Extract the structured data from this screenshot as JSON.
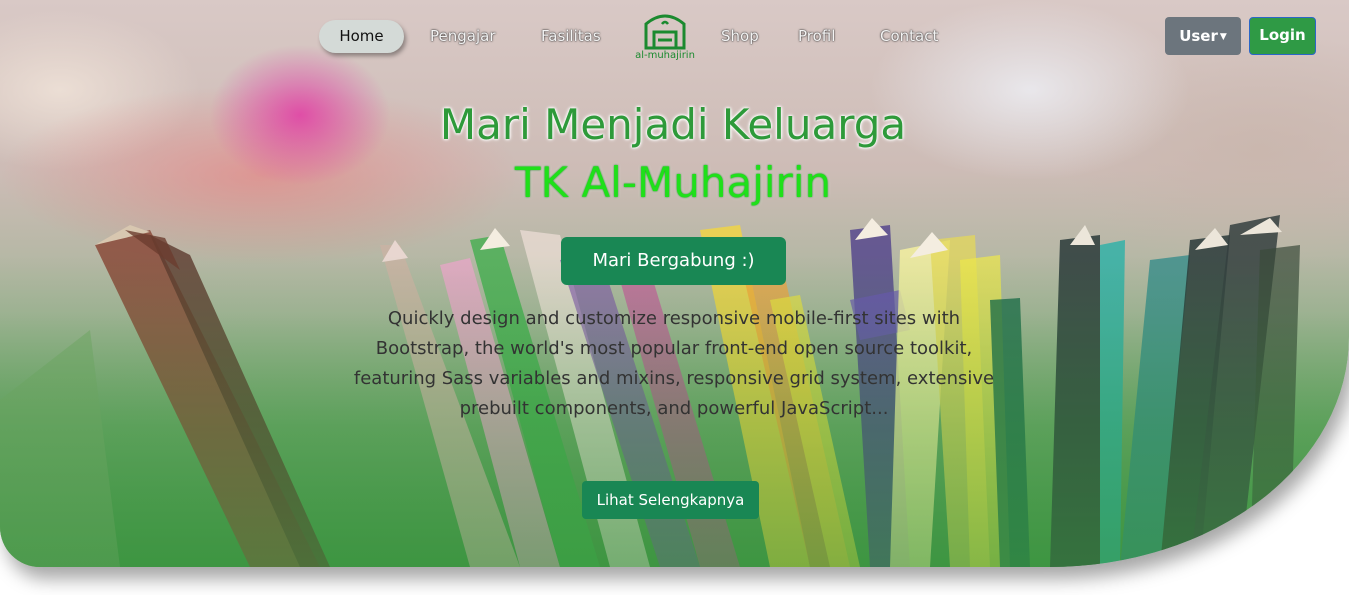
{
  "nav": {
    "items": [
      {
        "label": "Home"
      },
      {
        "label": "Pengajar"
      },
      {
        "label": "Fasilitas"
      },
      {
        "label": "Shop"
      },
      {
        "label": "Profil"
      },
      {
        "label": "Contact"
      }
    ],
    "logo_text": "al-muhajirin",
    "user_label": "User",
    "login_label": "Login"
  },
  "hero": {
    "headline_line1": "Mari Menjadi Keluarga",
    "headline_line2": "TK Al-Muhajirin",
    "join_button": "Mari Bergabung :)",
    "description": "Quickly design and customize responsive mobile-first sites with Bootstrap, the world's most popular front-end open source toolkit, featuring Sass variables and mixins, responsive grid system, extensive prebuilt components, and powerful JavaScript...",
    "more_button": "Lihat Selengkapnya"
  },
  "colors": {
    "primary_green": "#198754",
    "headline_green": "#2e9a3a",
    "accent_green": "#1fe01a",
    "user_button": "#6c757d",
    "login_button": "#2f9a45"
  },
  "icons": {
    "logo": "mosque-logo-icon",
    "user_caret": "caret-down-icon"
  }
}
